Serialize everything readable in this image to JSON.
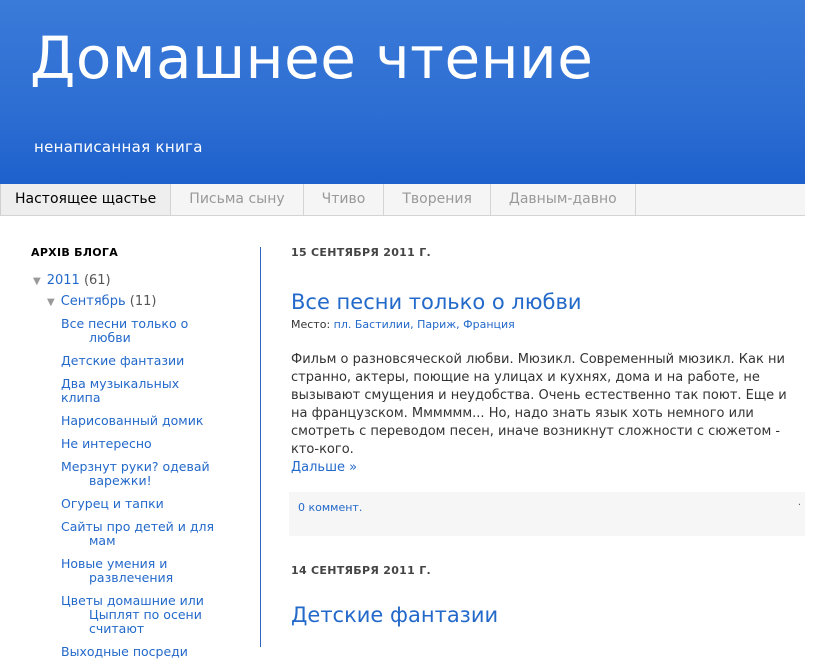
{
  "header": {
    "title": "Домашнее чтение",
    "description": "ненаписанная книга"
  },
  "tabs": [
    {
      "label": "Настоящее щастье",
      "active": true
    },
    {
      "label": "Письма сыну",
      "active": false
    },
    {
      "label": "Чтиво",
      "active": false
    },
    {
      "label": "Творения",
      "active": false
    },
    {
      "label": "Давным-давно",
      "active": false
    }
  ],
  "sidebar": {
    "heading": "АРХІВ БЛОГА",
    "year": {
      "label": "2011",
      "count": "(61)"
    },
    "month": {
      "label": "Сентябрь",
      "count": "(11)"
    },
    "posts": [
      {
        "l1": "Все песни только о",
        "l2": "любви"
      },
      {
        "l1": "Детские фантазии",
        "l2": ""
      },
      {
        "l1": "Два музыкальных клипа",
        "l2": ""
      },
      {
        "l1": "Нарисованный домик",
        "l2": ""
      },
      {
        "l1": "Не интересно",
        "l2": ""
      },
      {
        "l1": "Мерзнут руки? одевай",
        "l2": "варежки!"
      },
      {
        "l1": "Огурец и тапки",
        "l2": ""
      },
      {
        "l1": "Сайты про детей и для",
        "l2": "мам"
      },
      {
        "l1": "Новые умения и",
        "l2": "развлечения"
      },
      {
        "l1": "Цветы домашние или",
        "l2": "Цыплят по осени"
      },
      {
        "l1": "Выходные посреди",
        "l2": ""
      }
    ],
    "post9_l3": "считают"
  },
  "post1": {
    "date": "15 СЕНТЯБРЯ 2011 Г.",
    "title": "Все песни только о любви",
    "location_label": "Место:",
    "location": "пл. Бастилии, Париж, Франция",
    "body": "Фильм о разновсяческой любви. Мюзикл. Современный мюзикл. Как ни странно, актеры, поющие на улицах и кухнях, дома и на работе, не вызывают смущения и неудобства. Очень естественно так поют. Еще и на французском. Мммммм... Но, надо знать язык хоть немного или смотреть с переводом песен, иначе возникнут сложности с сюжетом - кто-кого.",
    "more": "Дальше »",
    "comments": "0 коммент."
  },
  "post2": {
    "date": "14 СЕНТЯБРЯ 2011 Г.",
    "title": "Детские фантазии"
  },
  "colors": {
    "header_blue": "#2d6ed3",
    "link_blue": "#2369ca"
  }
}
